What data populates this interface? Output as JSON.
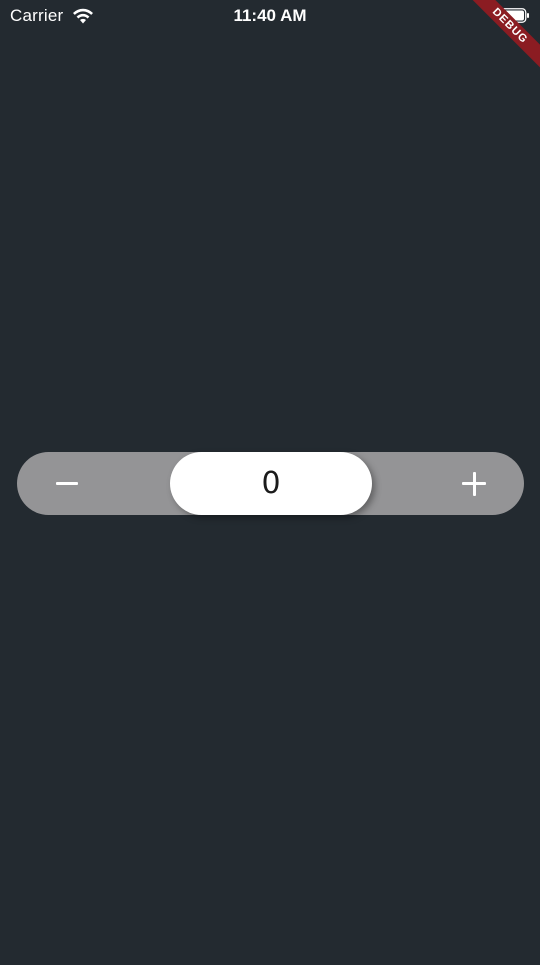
{
  "status_bar": {
    "carrier": "Carrier",
    "time": "11:40 AM",
    "wifi_icon": "wifi-icon",
    "battery_icon": "battery-icon"
  },
  "debug_banner": {
    "label": "DEBUG",
    "color": "#8b1c22"
  },
  "stepper": {
    "value": "0",
    "decrement_icon": "minus-icon",
    "increment_icon": "plus-icon",
    "track_color": "#949496",
    "thumb_color": "#ffffff"
  },
  "colors": {
    "background": "#232a30"
  }
}
